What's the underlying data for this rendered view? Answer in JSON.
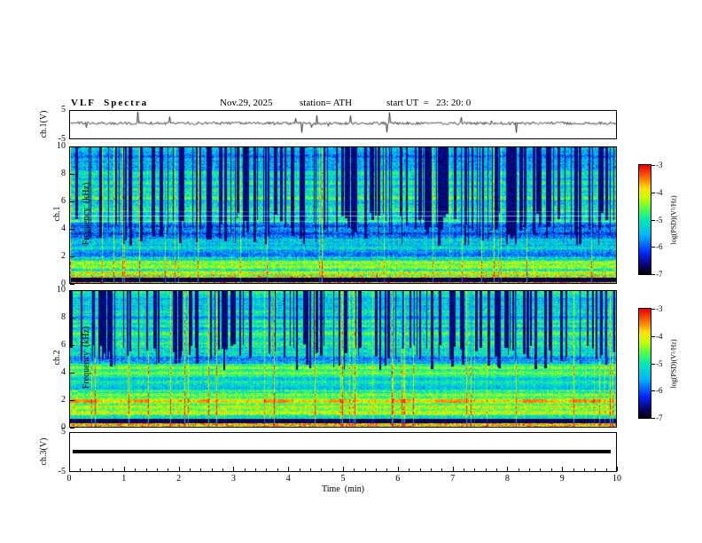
{
  "header": {
    "title": "VLF  Spectra",
    "date": "Nov.29, 2025",
    "station": "station= ATH",
    "start_ut": "start UT  =   23: 20: 0"
  },
  "xaxis": {
    "label": "Time  (min)",
    "ticks": [
      "0",
      "1",
      "2",
      "3",
      "4",
      "5",
      "6",
      "7",
      "8",
      "9",
      "10"
    ]
  },
  "panels": {
    "wave1": {
      "ylabel": "ch.1(V)",
      "ymax": "5",
      "ymin": "-5"
    },
    "spec1": {
      "ylabel_line1": "ch.1",
      "ylabel_line2": "Frequency  (kHz)",
      "yticks": [
        "10",
        "8",
        "6",
        "4",
        "2",
        "0"
      ]
    },
    "spec2": {
      "ylabel_line1": "ch.2",
      "ylabel_line2": "Frequency  (kHz)",
      "yticks": [
        "10",
        "8",
        "6",
        "4",
        "2",
        "0"
      ]
    },
    "wave3": {
      "ylabel": "ch.3(V)",
      "ymax": "5",
      "ymin": "-5"
    }
  },
  "colorbar": {
    "label": "log(PSD)(V²/Hz)",
    "ticks": [
      "-3",
      "-4",
      "-5",
      "-6",
      "-7"
    ],
    "top_color": "#eb0000",
    "bottom_color": "#000000"
  },
  "chart_data": [
    {
      "type": "line",
      "name": "ch1-waveform",
      "ylabel": "ch.1(V)",
      "xlim_min": [
        0,
        10
      ],
      "ylim_v": [
        -5,
        5
      ],
      "description": "Noisy broadband voltage trace centered near 0 V with dense small fluctuations of about ±0.5 V and frequent impulsive spikes reaching roughly ±4 V throughout the 10-minute record."
    },
    {
      "type": "heatmap",
      "name": "ch1-spectrogram",
      "ylabel": "ch.1 Frequency (kHz)",
      "xlim_min": [
        0,
        10
      ],
      "ylim_khz": [
        0,
        10
      ],
      "zlabel": "log(PSD)(V²/Hz)",
      "zlim": [
        -7,
        -3
      ],
      "colormap": "jet-like (black/dark-blue low, cyan/green mid, yellow/red high)",
      "features": [
        "background PSD about -5 to -4.5 (cyan/green) below 3 kHz",
        "darker blue region (about -6) between roughly 3 and 6 kHz",
        "dense dark-blue vertical dropout streaks (about -7) extending from 10 kHz down to 3-5 kHz across the whole record",
        "scattered bright green vertical lines",
        "enhanced green/yellow power (about -4) below 2 kHz with horizontal banding",
        "solid black horizontal band (about -7) near 0.2-0.45 kHz with a bright multicolour line at the very bottom",
        "thin whitish horizontal interference lines near 4.6-5.3 kHz"
      ]
    },
    {
      "type": "heatmap",
      "name": "ch2-spectrogram",
      "ylabel": "ch.2 Frequency (kHz)",
      "xlim_min": [
        0,
        10
      ],
      "ylim_khz": [
        0,
        10
      ],
      "zlabel": "log(PSD)(V²/Hz)",
      "zlim": [
        -7,
        -3
      ],
      "colormap": "jet-like (black/dark-blue low, cyan/green mid, yellow/red high)",
      "features": [
        "green/yellow enhanced power (about -4.5 to -4) below 4.5 kHz with strong horizontal banding",
        "orange/red dashed horizontal segments (about -3.5) near 2 kHz",
        "darker blue region (about -6) above 5 kHz",
        "dense dark-blue vertical dropout streaks (about -7) from 10 kHz down to about 4.5 kHz",
        "black band (about -7) near 0.3-0.6 kHz with a bright yellow/red line beneath it"
      ]
    },
    {
      "type": "line",
      "name": "ch3-waveform",
      "ylabel": "ch.3(V)",
      "xlim_min": [
        0,
        10
      ],
      "ylim_v": [
        -5,
        5
      ],
      "constant_value": 0,
      "description": "Perfectly flat thick black line at 0 V for the entire record (channel inactive)."
    }
  ]
}
